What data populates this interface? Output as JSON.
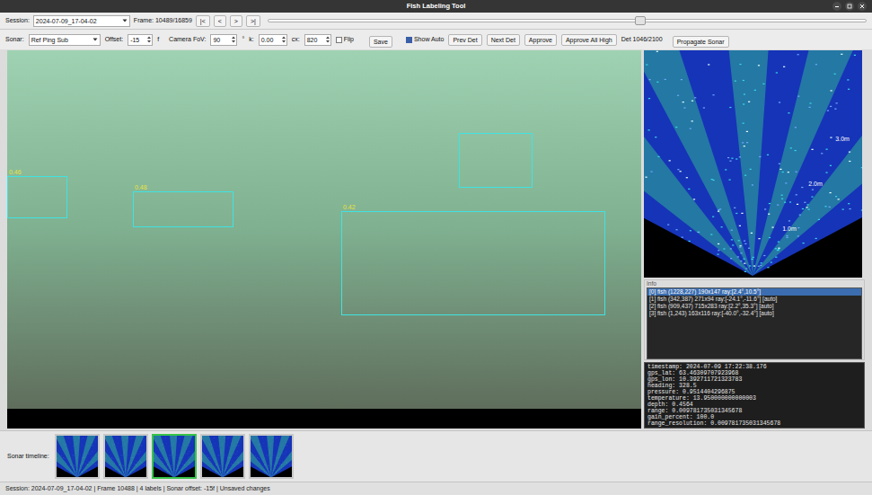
{
  "window": {
    "title": "Fish Labeling Tool"
  },
  "toolbar_top": {
    "session_label": "Session:",
    "session_value": "2024-07-09_17-04-02",
    "frame_label": "Frame: 10489/16859",
    "nav_buttons": [
      "|<",
      "<",
      ">",
      ">|"
    ],
    "frame_slider": {
      "level": 0.622
    }
  },
  "toolbar_bottom": {
    "sonar_label": "Sonar:",
    "sonar_value": "Ref Ping Sub",
    "offset_label": "Offset:",
    "offset_value": "-15",
    "offset_unit": "f",
    "fov_label": "Camera FoV:",
    "fov_value": "90",
    "fov_unit": "°",
    "k_label": "k:",
    "k_value": "0.00",
    "cx_label": "cx:",
    "cx_value": "820",
    "flip": {
      "label": "Flip",
      "checked": false
    },
    "save": "Save",
    "show_auto": {
      "label": "Show Auto",
      "checked": true
    },
    "buttons": [
      "Prev Det",
      "Next Det",
      "Approve",
      "Approve All High"
    ],
    "det_counter": "Det 1046/2100",
    "propagate": "Propagate Sonar"
  },
  "video": {
    "detections": [
      {
        "score": "0.46",
        "labeled": true
      },
      {
        "score": "0.48",
        "labeled": true
      },
      {
        "score": "0.42",
        "labeled": true
      },
      {
        "score": "",
        "labeled": false
      }
    ]
  },
  "sonar": {
    "range_labels": [
      "3.0m",
      "2.0m",
      "1.0m"
    ]
  },
  "info": {
    "title": "Info",
    "detections": [
      {
        "text": "[0] fish (1228,227) 190x147 ray:[2.4°,10.5°]",
        "selected": true
      },
      {
        "text": "[1] fish (342,387) 271x94 ray:[-24.1°,-11.6°] [auto]",
        "selected": false
      },
      {
        "text": "[2] fish (909,437) 715x283 ray:[2.2°,35.3°] [auto]",
        "selected": false
      },
      {
        "text": "[3] fish (1,243) 163x116 ray:[-40.0°,-32.4°] [auto]",
        "selected": false
      }
    ],
    "metadata": [
      "timestamp: 2024-07-09 17:22:38.176",
      "gps_lat: 63.46309707923968",
      "gps_lon: 10.392711721323783",
      "heading: 328.5",
      "pressure: 0.9514404296875",
      "temperature: 13.950000000000003",
      "depth: 0.4564",
      "range: 0.009781735031345678",
      "gain_percent: 100.0",
      "range_resolution: 0.009781735031345678"
    ]
  },
  "timeline": {
    "label": "Sonar timeline:",
    "frames": [
      {
        "selected": false
      },
      {
        "selected": false
      },
      {
        "selected": true
      },
      {
        "selected": false
      },
      {
        "selected": false
      }
    ]
  },
  "status_bar": "Session: 2024-07-09_17-04-02 | Frame 10488 | 4 labels | Sonar offset: -15f | Unsaved changes"
}
